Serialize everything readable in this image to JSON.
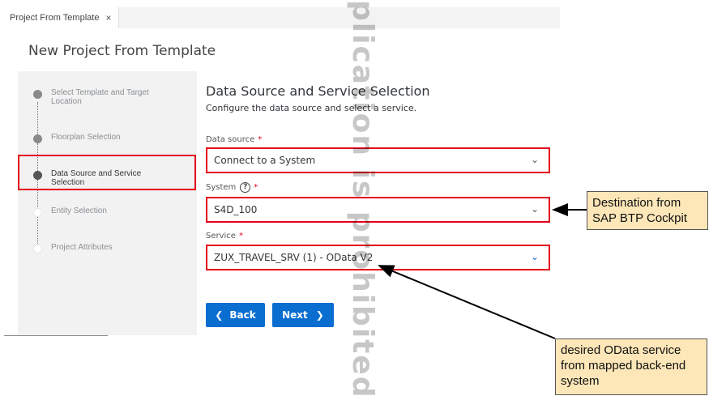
{
  "tab": {
    "label": "Project From Template",
    "close": "×"
  },
  "page_title": "New Project From Template",
  "steps": [
    {
      "label": "Select Template and Target Location"
    },
    {
      "label": "Floorplan Selection"
    },
    {
      "label": "Data Source and Service Selection"
    },
    {
      "label": "Entity Selection"
    },
    {
      "label": "Project Attributes"
    }
  ],
  "content": {
    "title": "Data Source and Service Selection",
    "subtitle": "Configure the data source and select a service."
  },
  "fields": {
    "data_source": {
      "label": "Data source",
      "required": "*",
      "value": "Connect to a System"
    },
    "system": {
      "label": "System",
      "help": "?",
      "required": "*",
      "value": "S4D_100"
    },
    "service": {
      "label": "Service",
      "required": "*",
      "value": "ZUX_TRAVEL_SRV (1) - OData V2"
    }
  },
  "buttons": {
    "back": "Back",
    "next": "Next"
  },
  "icons": {
    "back": "chevron-left-icon",
    "next": "chevron-right-icon",
    "dropdown": "chevron-down-icon",
    "help": "help-circle-icon",
    "close": "close-icon"
  },
  "callouts": {
    "destination": "Destination from SAP BTP Cockpit",
    "service": "desired OData service from mapped back-end system"
  },
  "watermark": "plication is prohibited",
  "colors": {
    "accent": "#0a6ed1",
    "highlight": "#e4001b",
    "callout_bg": "#fde6b8"
  }
}
